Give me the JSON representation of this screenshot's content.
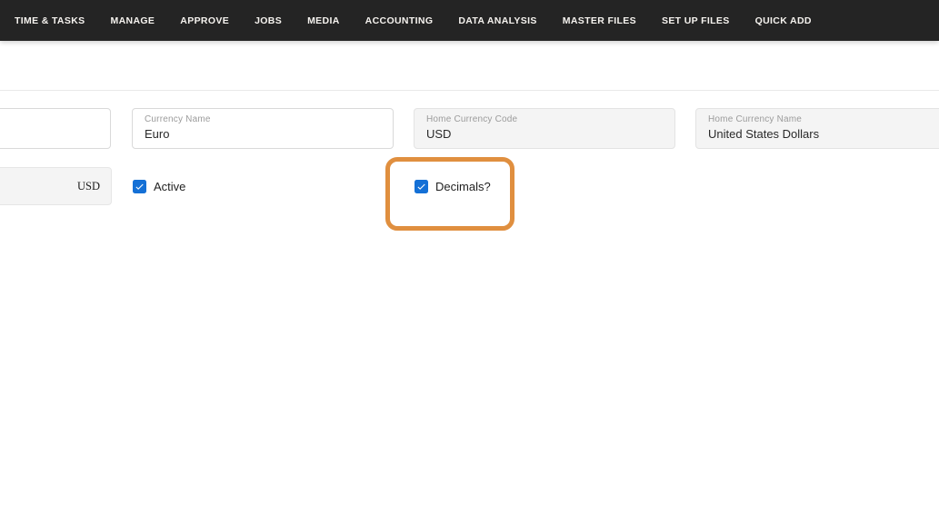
{
  "nav": {
    "items": [
      {
        "label": "TIME & TASKS"
      },
      {
        "label": "MANAGE"
      },
      {
        "label": "APPROVE"
      },
      {
        "label": "JOBS"
      },
      {
        "label": "MEDIA"
      },
      {
        "label": "ACCOUNTING"
      },
      {
        "label": "DATA ANALYSIS"
      },
      {
        "label": "MASTER FILES"
      },
      {
        "label": "SET UP FILES"
      },
      {
        "label": "QUICK ADD"
      }
    ]
  },
  "form": {
    "currency_symbol": {
      "value": "USD"
    },
    "currency_name": {
      "label": "Currency Name",
      "value": "Euro"
    },
    "home_currency_code": {
      "label": "Home Currency Code",
      "value": "USD"
    },
    "home_currency_name": {
      "label": "Home Currency Name",
      "value": "United States Dollars"
    },
    "active": {
      "label": "Active",
      "checked": true
    },
    "decimals": {
      "label": "Decimals?",
      "checked": true
    }
  },
  "colors": {
    "navbar_bg": "#242424",
    "checkbox_blue": "#1470d6",
    "highlight_orange": "#e08f3f",
    "readonly_field_bg": "#f4f4f4"
  }
}
